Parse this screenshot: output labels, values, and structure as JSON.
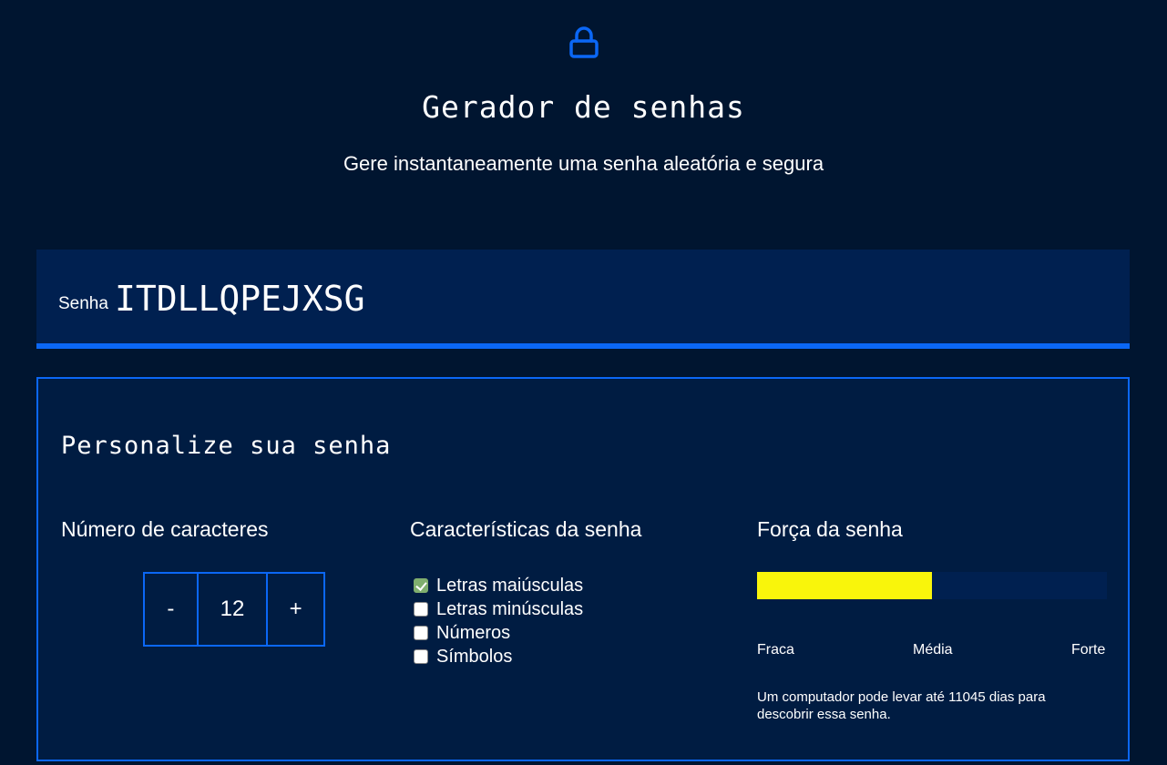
{
  "header": {
    "icon": "lock-icon",
    "title": "Gerador de senhas",
    "subtitle": "Gere instantaneamente uma senha aleatória e segura"
  },
  "password": {
    "label": "Senha",
    "value": "ITDLLQPEJXSG"
  },
  "panel": {
    "title": "Personalize sua senha",
    "length": {
      "heading": "Número de caracteres",
      "decrement_label": "-",
      "value": "12",
      "increment_label": "+"
    },
    "options": {
      "heading": "Características da senha",
      "items": [
        {
          "label": "Letras maiúsculas",
          "checked": true
        },
        {
          "label": "Letras minúsculas",
          "checked": false
        },
        {
          "label": "Números",
          "checked": false
        },
        {
          "label": "Símbolos",
          "checked": false
        }
      ]
    },
    "strength": {
      "heading": "Força da senha",
      "level_fraction": 0.5,
      "fill_color": "#f9f50b",
      "labels": [
        "Fraca",
        "Média",
        "Forte"
      ],
      "note": "Um computador pode levar até 11045 dias para descobrir essa senha."
    }
  },
  "colors": {
    "background": "#001530",
    "panel": "#001c42",
    "accent": "#0b67f5"
  }
}
